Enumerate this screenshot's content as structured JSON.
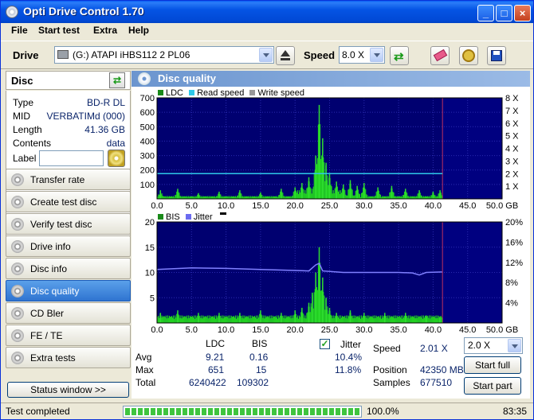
{
  "window": {
    "title": "Opti Drive Control 1.70"
  },
  "menu": [
    "File",
    "Start test",
    "Extra",
    "Help"
  ],
  "drivebar": {
    "drive_label": "Drive",
    "drive_value": "(G:)  ATAPI iHBS112   2 PL06",
    "speed_label": "Speed",
    "speed_value": "8.0 X"
  },
  "disc": {
    "header": "Disc",
    "rows": [
      {
        "label": "Type",
        "value": "BD-R DL"
      },
      {
        "label": "MID",
        "value": "VERBATIMd (000)"
      },
      {
        "label": "Length",
        "value": "41.36 GB"
      },
      {
        "label": "Contents",
        "value": "data"
      }
    ],
    "label_field": "Label",
    "label_value": ""
  },
  "nav": [
    {
      "label": "Transfer rate",
      "active": false
    },
    {
      "label": "Create test disc",
      "active": false
    },
    {
      "label": "Verify test disc",
      "active": false
    },
    {
      "label": "Drive info",
      "active": false
    },
    {
      "label": "Disc info",
      "active": false
    },
    {
      "label": "Disc quality",
      "active": true
    },
    {
      "label": "CD Bler",
      "active": false
    },
    {
      "label": "FE / TE",
      "active": false
    },
    {
      "label": "Extra tests",
      "active": false
    }
  ],
  "status_window_button": "Status window >>",
  "panel_title": "Disc quality",
  "chart_data": [
    {
      "type": "bar",
      "legend": [
        "LDC",
        "Read speed",
        "Write speed"
      ],
      "colors": {
        "LDC": "#2fc42f",
        "Read speed": "#2ec8e8",
        "Write speed": "#999999"
      },
      "x_range": [
        0,
        50
      ],
      "x_ticks": [
        "0.0",
        "5.0",
        "10.0",
        "15.0",
        "20.0",
        "25.0",
        "30.0",
        "35.0",
        "40.0",
        "45.0",
        "50.0 GB"
      ],
      "y_range": [
        0,
        700
      ],
      "y_ticks": [
        "100",
        "200",
        "300",
        "400",
        "500",
        "600",
        "700"
      ],
      "y2_ticks": [
        "1 X",
        "2 X",
        "3 X",
        "4 X",
        "5 X",
        "6 X",
        "7 X",
        "8 X"
      ],
      "read_speed_x": 2.0,
      "disc_end_gb": 41.36,
      "ldc_spikes": [
        [
          0.5,
          60
        ],
        [
          3,
          70
        ],
        [
          6,
          40
        ],
        [
          9,
          50
        ],
        [
          12,
          60
        ],
        [
          15,
          45
        ],
        [
          18,
          70
        ],
        [
          20,
          80
        ],
        [
          21,
          110
        ],
        [
          22,
          150
        ],
        [
          23,
          300
        ],
        [
          23.5,
          651
        ],
        [
          24,
          420
        ],
        [
          24.5,
          250
        ],
        [
          25,
          180
        ],
        [
          26,
          120
        ],
        [
          27,
          100
        ],
        [
          28,
          130
        ],
        [
          29,
          90
        ],
        [
          30,
          110
        ],
        [
          32,
          80
        ],
        [
          34,
          90
        ],
        [
          36,
          70
        ],
        [
          38,
          60
        ],
        [
          40,
          50
        ],
        [
          41,
          60
        ]
      ]
    },
    {
      "type": "bar",
      "legend": [
        "BIS",
        "Jitter"
      ],
      "colors": {
        "BIS": "#2fc42f",
        "Jitter": "#6b6bf0"
      },
      "x_range": [
        0,
        50
      ],
      "x_ticks": [
        "0.0",
        "5.0",
        "10.0",
        "15.0",
        "20.0",
        "25.0",
        "30.0",
        "35.0",
        "40.0",
        "45.0",
        "50.0 GB"
      ],
      "y_range": [
        0,
        20
      ],
      "y_ticks": [
        "5",
        "10",
        "15",
        "20"
      ],
      "y2_ticks": [
        "4%",
        "8%",
        "12%",
        "16%",
        "20%"
      ],
      "jitter_points": [
        [
          0,
          10.6
        ],
        [
          5,
          10.9
        ],
        [
          10,
          10.8
        ],
        [
          15,
          10.6
        ],
        [
          20,
          10.4
        ],
        [
          22,
          10.3
        ],
        [
          23,
          11.5
        ],
        [
          23.5,
          11.8
        ],
        [
          24,
          10.3
        ],
        [
          27,
          10.0
        ],
        [
          30,
          10.0
        ],
        [
          35,
          10.0
        ],
        [
          37,
          9.9
        ],
        [
          38,
          9.5
        ],
        [
          39,
          10.0
        ],
        [
          41.3,
          10.1
        ]
      ],
      "bis_spikes": [
        [
          0.5,
          2
        ],
        [
          3,
          2.5
        ],
        [
          6,
          2
        ],
        [
          9,
          2
        ],
        [
          12,
          2
        ],
        [
          15,
          2.5
        ],
        [
          18,
          2
        ],
        [
          20,
          2.5
        ],
        [
          21,
          3
        ],
        [
          22,
          4
        ],
        [
          22.5,
          6
        ],
        [
          23,
          10
        ],
        [
          23.5,
          15
        ],
        [
          24,
          9
        ],
        [
          24.5,
          5
        ],
        [
          25,
          3
        ],
        [
          26,
          2
        ],
        [
          28,
          2.5
        ],
        [
          30,
          2
        ],
        [
          33,
          2
        ],
        [
          36,
          2
        ],
        [
          39,
          1.5
        ],
        [
          41,
          1
        ]
      ]
    }
  ],
  "stats": {
    "col_ldc": "LDC",
    "col_bis": "BIS",
    "rows": [
      {
        "label": "Avg",
        "ldc": "9.21",
        "bis": "0.16"
      },
      {
        "label": "Max",
        "ldc": "651",
        "bis": "15"
      },
      {
        "label": "Total",
        "ldc": "6240422",
        "bis": "109302"
      }
    ],
    "jitter_label": "Jitter",
    "jitter_avg": "10.4%",
    "jitter_max": "11.8%",
    "speed_label": "Speed",
    "speed_value": "2.01 X",
    "position_label": "Position",
    "position_value": "42350 MB",
    "samples_label": "Samples",
    "samples_value": "677510",
    "speed_select": "2.0 X",
    "start_full": "Start full",
    "start_part": "Start part"
  },
  "statusbar": {
    "status_text": "Test completed",
    "progress_text": "100.0%",
    "time": "83:35",
    "progress_fraction": 1.0
  }
}
